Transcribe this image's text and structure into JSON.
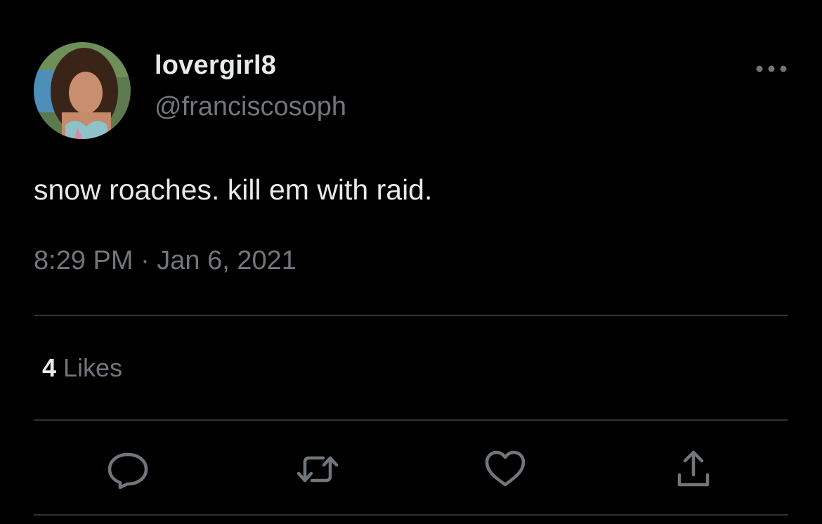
{
  "user": {
    "display_name": "lovergirl8",
    "handle": "@franciscosoph",
    "avatar_icon": "profile-photo"
  },
  "tweet": {
    "text": "snow roaches. kill em with raid.",
    "timestamp": "8:29 PM · Jan 6, 2021"
  },
  "stats": {
    "likes_count": "4",
    "likes_label": "Likes"
  },
  "actions": {
    "reply_icon": "reply-icon",
    "retweet_icon": "retweet-icon",
    "like_icon": "heart-icon",
    "share_icon": "share-icon",
    "more_icon": "more-icon"
  },
  "colors": {
    "background": "#000000",
    "primary_text": "#e7e9ea",
    "secondary_text": "#71767b",
    "divider": "#2f3336"
  }
}
